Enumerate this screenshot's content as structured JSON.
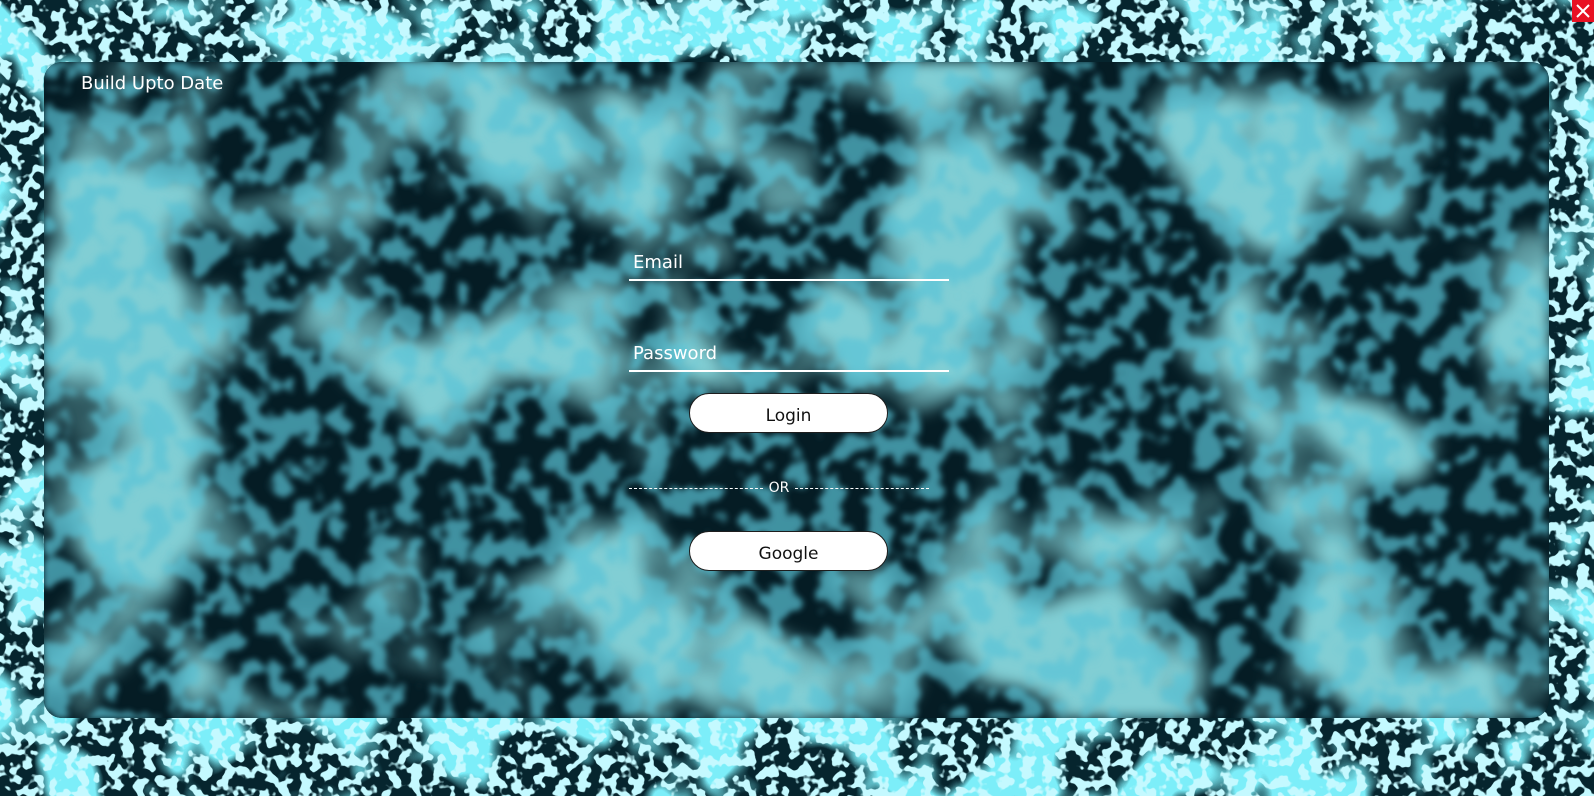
{
  "app": {
    "title": "Build Upto Date"
  },
  "window": {
    "close_icon": "close-icon"
  },
  "login_form": {
    "email": {
      "placeholder": "Email",
      "value": ""
    },
    "password": {
      "placeholder": "Password",
      "value": ""
    },
    "login_button": "Login",
    "divider_text": "OR",
    "google_button": "Google"
  },
  "colors": {
    "background_dark": "#06252e",
    "splash_cyan": "#3fdcf2",
    "panel_tint": "#0a3039",
    "close_red": "#e81123",
    "text_white": "#ffffff"
  }
}
